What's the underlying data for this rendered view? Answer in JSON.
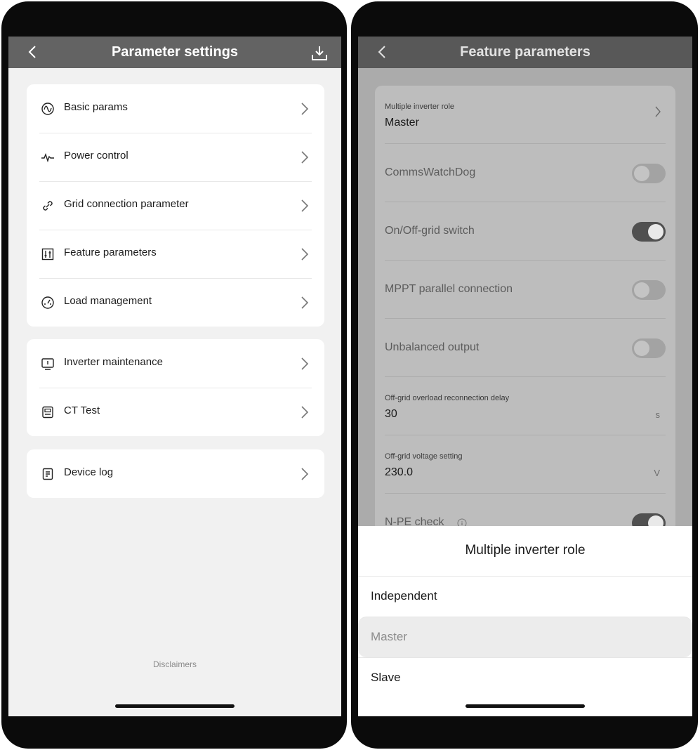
{
  "left_screen": {
    "navbar": {
      "title": "Parameter settings",
      "back_icon": "chevron-left-icon",
      "action_icon": "download-icon"
    },
    "groups": [
      {
        "items": [
          {
            "label": "Basic params",
            "icon": "wave-circle-icon"
          },
          {
            "label": "Power control",
            "icon": "pulse-icon"
          },
          {
            "label": "Grid connection parameter",
            "icon": "link-icon"
          },
          {
            "label": "Feature parameters",
            "icon": "sliders-box-icon"
          },
          {
            "label": "Load management",
            "icon": "gauge-icon"
          }
        ]
      },
      {
        "items": [
          {
            "label": "Inverter maintenance",
            "icon": "monitor-icon"
          },
          {
            "label": "CT Test",
            "icon": "meter-icon"
          }
        ]
      },
      {
        "items": [
          {
            "label": "Device log",
            "icon": "document-icon"
          }
        ]
      }
    ],
    "footer": {
      "disclaimer": "Disclaimers"
    }
  },
  "right_screen": {
    "navbar": {
      "title": "Feature parameters",
      "back_icon": "chevron-left-icon"
    },
    "rows": {
      "multiple_inverter_role": {
        "label": "Multiple inverter role",
        "value": "Master"
      },
      "comms_watchdog": {
        "label": "CommsWatchDog",
        "on": false
      },
      "on_off_grid_switch": {
        "label": "On/Off-grid switch",
        "on": true
      },
      "mppt_parallel": {
        "label": "MPPT parallel connection",
        "on": false
      },
      "unbalanced_output": {
        "label": "Unbalanced output",
        "on": false
      },
      "overload_delay": {
        "label": "Off-grid overload reconnection delay",
        "value": "30",
        "unit": "s"
      },
      "voltage_setting": {
        "label": "Off-grid voltage setting",
        "value": "230.0",
        "unit": "V"
      },
      "npe_check": {
        "label": "N-PE check",
        "on": true,
        "info_icon": "info-circle-icon"
      }
    },
    "sheet": {
      "title": "Multiple inverter role",
      "options": [
        "Independent",
        "Master",
        "Slave"
      ],
      "selected": "Master"
    }
  },
  "colors": {
    "navbar": "#636363",
    "background": "#f1f1f1",
    "card": "#ffffff",
    "toggle_on": "#505050"
  }
}
